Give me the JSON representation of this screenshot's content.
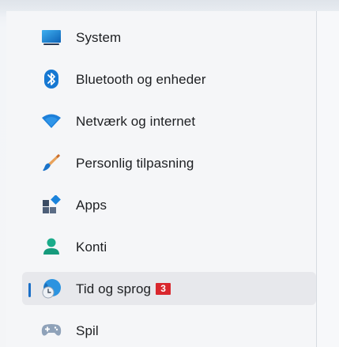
{
  "nav": {
    "items": [
      {
        "label": "System",
        "icon": "display-icon"
      },
      {
        "label": "Bluetooth og enheder",
        "icon": "bluetooth-icon"
      },
      {
        "label": "Netværk og internet",
        "icon": "wifi-icon"
      },
      {
        "label": "Personlig tilpasning",
        "icon": "paintbrush-icon"
      },
      {
        "label": "Apps",
        "icon": "apps-icon"
      },
      {
        "label": "Konti",
        "icon": "account-icon"
      },
      {
        "label": "Tid og sprog",
        "icon": "time-language-icon",
        "selected": true,
        "badge": "3"
      },
      {
        "label": "Spil",
        "icon": "gamepad-icon"
      }
    ]
  },
  "colors": {
    "selection_indicator": "#1b6fc7",
    "selected_row_background": "#e7e8ec",
    "badge_background": "#d9272e",
    "panel_background": "#f5f6f8"
  }
}
